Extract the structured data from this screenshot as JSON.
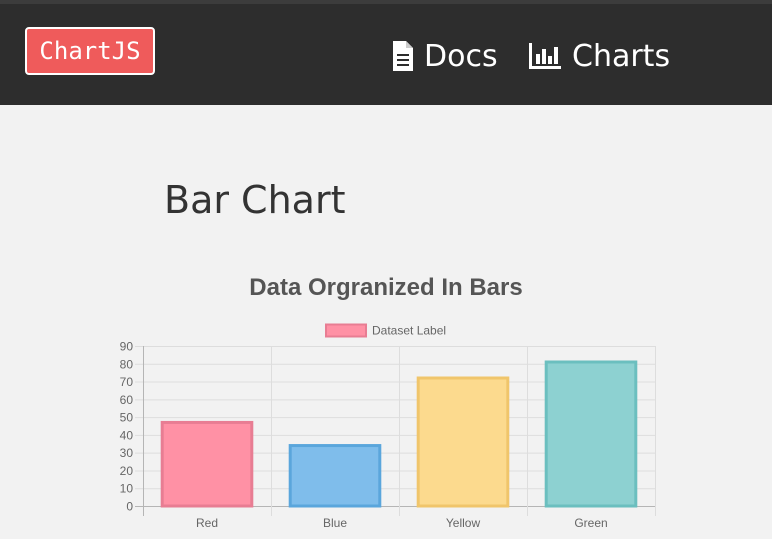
{
  "navbar": {
    "brand": "ChartJS",
    "links": [
      {
        "label": "Docs",
        "icon": "file-text-icon"
      },
      {
        "label": "Charts",
        "icon": "bar-chart-icon"
      }
    ],
    "background": "#2d2d2d",
    "brand_color": "#ef5b5b"
  },
  "page": {
    "title": "Bar Chart"
  },
  "chart_data": {
    "type": "bar",
    "title": "Data Orgranized In Bars",
    "categories": [
      "Red",
      "Blue",
      "Yellow",
      "Green"
    ],
    "series": [
      {
        "name": "Dataset Label",
        "values": [
          47,
          34,
          72,
          81
        ],
        "fill_colors": [
          "#ff91a5",
          "#7fbdeb",
          "#fcda8e",
          "#8dd1d1"
        ],
        "border_colors": [
          "#e87d93",
          "#5aa6dc",
          "#f0c56b",
          "#6bbfbf"
        ]
      }
    ],
    "ylim": [
      0,
      90
    ],
    "yticks": [
      0,
      10,
      20,
      30,
      40,
      50,
      60,
      70,
      80,
      90
    ],
    "grid": true,
    "legend": "top-center",
    "xlabel": "",
    "ylabel": ""
  }
}
